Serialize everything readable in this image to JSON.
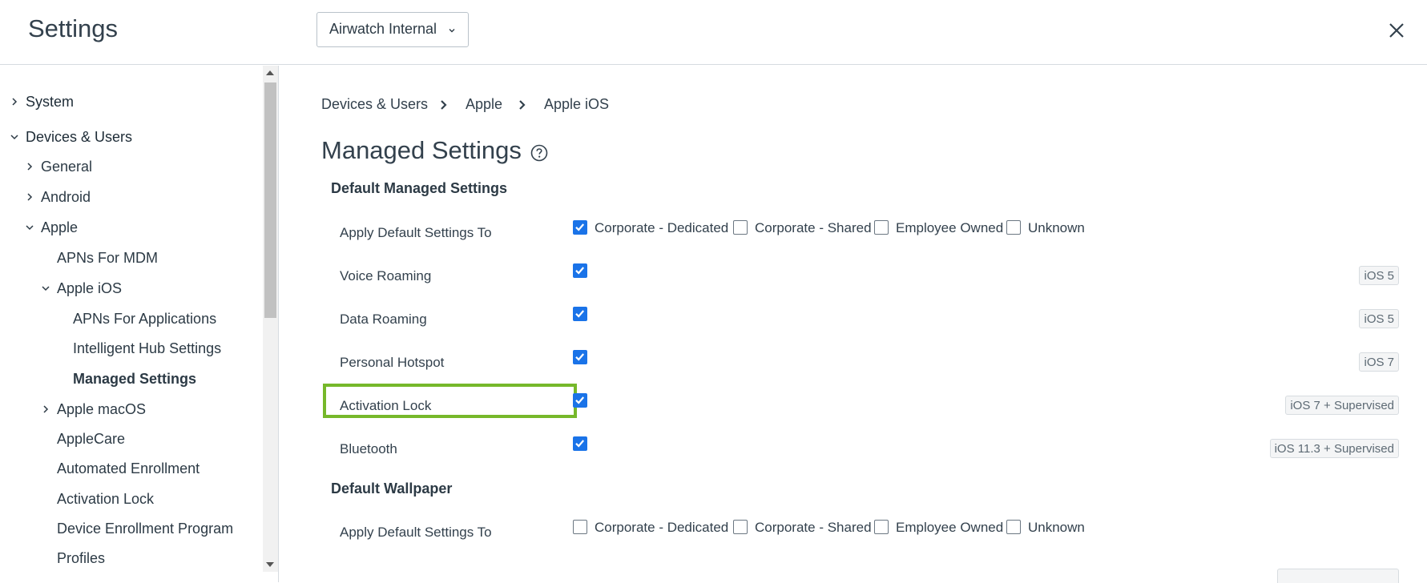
{
  "header": {
    "title": "Settings",
    "org_group": "Airwatch Internal"
  },
  "sidebar": {
    "items": [
      {
        "label": "System"
      },
      {
        "label": "Devices & Users"
      },
      {
        "label": "General"
      },
      {
        "label": "Android"
      },
      {
        "label": "Apple"
      },
      {
        "label": "APNs For MDM"
      },
      {
        "label": "Apple iOS"
      },
      {
        "label": "APNs For Applications"
      },
      {
        "label": "Intelligent Hub Settings"
      },
      {
        "label": "Managed Settings"
      },
      {
        "label": "Apple macOS"
      },
      {
        "label": "AppleCare"
      },
      {
        "label": "Automated Enrollment"
      },
      {
        "label": "Activation Lock"
      },
      {
        "label": "Device Enrollment Program"
      },
      {
        "label": "Profiles"
      }
    ]
  },
  "breadcrumb": [
    "Devices & Users",
    "Apple",
    "Apple iOS"
  ],
  "page": {
    "title": "Managed Settings",
    "sections": [
      {
        "title": "Default Managed Settings",
        "rows": [
          {
            "label": "Apply Default Settings To",
            "options": [
              {
                "label": "Corporate - Dedicated",
                "checked": true
              },
              {
                "label": "Corporate - Shared",
                "checked": false
              },
              {
                "label": "Employee Owned",
                "checked": false
              },
              {
                "label": "Unknown",
                "checked": false
              }
            ]
          },
          {
            "label": "Voice Roaming",
            "checked": true,
            "badge": "iOS 5"
          },
          {
            "label": "Data Roaming",
            "checked": true,
            "badge": "iOS 5"
          },
          {
            "label": "Personal Hotspot",
            "checked": true,
            "badge": "iOS 7"
          },
          {
            "label": "Activation Lock",
            "checked": true,
            "badge": "iOS 7 + Supervised",
            "highlighted": true
          },
          {
            "label": "Bluetooth",
            "checked": true,
            "badge": "iOS 11.3 + Supervised"
          }
        ]
      },
      {
        "title": "Default Wallpaper",
        "rows": [
          {
            "label": "Apply Default Settings To",
            "options": [
              {
                "label": "Corporate - Dedicated",
                "checked": false
              },
              {
                "label": "Corporate - Shared",
                "checked": false
              },
              {
                "label": "Employee Owned",
                "checked": false
              },
              {
                "label": "Unknown",
                "checked": false
              }
            ]
          }
        ]
      }
    ]
  },
  "colors": {
    "accent_checkbox": "#1a73e8",
    "highlight_border": "#76b82a"
  }
}
